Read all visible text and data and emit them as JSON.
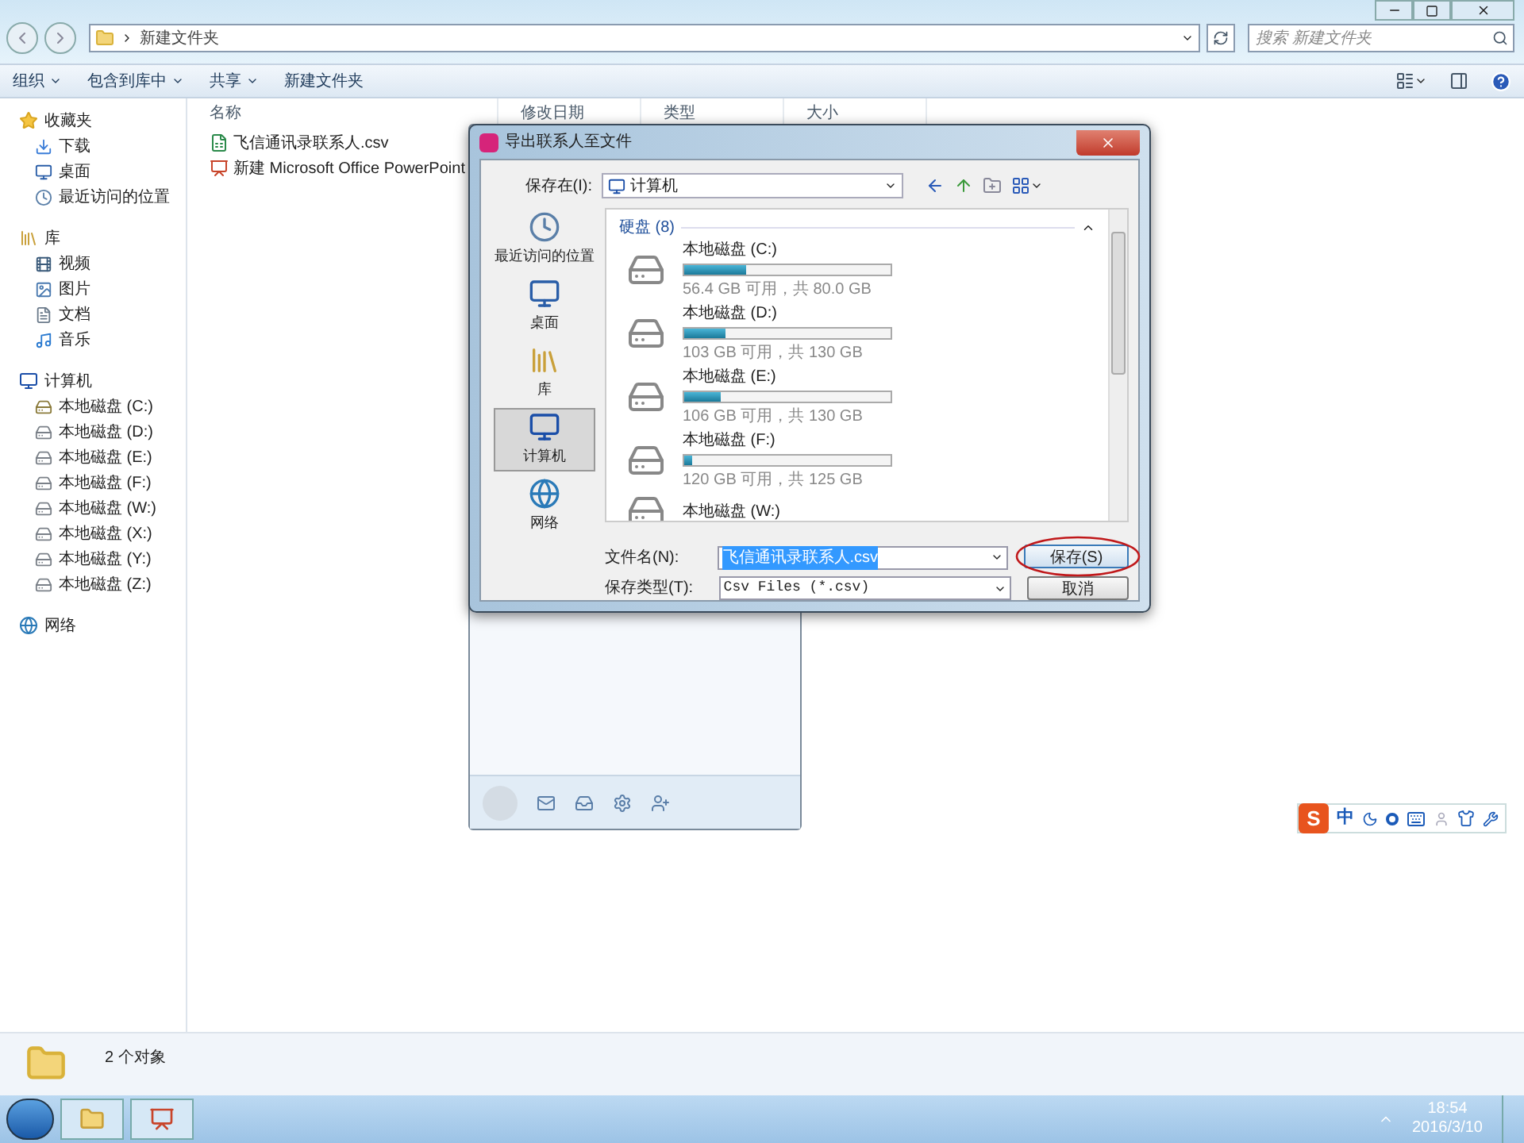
{
  "explorer": {
    "breadcrumb": "新建文件夹",
    "search": {
      "placeholder": "搜索 新建文件夹"
    },
    "toolbar": [
      {
        "label": "组织",
        "has_menu": true
      },
      {
        "label": "包含到库中",
        "has_menu": true
      },
      {
        "label": "共享",
        "has_menu": true
      },
      {
        "label": "新建文件夹",
        "has_menu": false
      }
    ],
    "sidebar": [
      {
        "label": "收藏夹",
        "kind": "favorites",
        "children": [
          {
            "label": "下载",
            "kind": "download"
          },
          {
            "label": "桌面",
            "kind": "desktop"
          },
          {
            "label": "最近访问的位置",
            "kind": "recent"
          }
        ]
      },
      {
        "label": "库",
        "kind": "library",
        "children": [
          {
            "label": "视频",
            "kind": "video"
          },
          {
            "label": "图片",
            "kind": "picture"
          },
          {
            "label": "文档",
            "kind": "document"
          },
          {
            "label": "音乐",
            "kind": "music"
          }
        ]
      },
      {
        "label": "计算机",
        "kind": "computer",
        "children": [
          {
            "label": "本地磁盘 (C:)",
            "kind": "system-drive"
          },
          {
            "label": "本地磁盘 (D:)",
            "kind": "drive"
          },
          {
            "label": "本地磁盘 (E:)",
            "kind": "drive"
          },
          {
            "label": "本地磁盘 (F:)",
            "kind": "drive"
          },
          {
            "label": "本地磁盘 (W:)",
            "kind": "drive"
          },
          {
            "label": "本地磁盘 (X:)",
            "kind": "drive"
          },
          {
            "label": "本地磁盘 (Y:)",
            "kind": "drive"
          },
          {
            "label": "本地磁盘 (Z:)",
            "kind": "drive"
          }
        ]
      },
      {
        "label": "网络",
        "kind": "network"
      }
    ],
    "columns": [
      "名称",
      "修改日期",
      "类型",
      "大小"
    ],
    "files": [
      {
        "name": "飞信通讯录联系人.csv",
        "kind": "csv"
      },
      {
        "name": "新建 Microsoft Office PowerPoint",
        "kind": "ppt"
      }
    ],
    "status": "2 个对象"
  },
  "dialog": {
    "title": "导出联系人至文件",
    "save_in_label": "保存在(I):",
    "save_in_value": "计算机",
    "places": [
      {
        "label": "最近访问的位置",
        "kind": "recent",
        "selected": false
      },
      {
        "label": "桌面",
        "kind": "desktop",
        "selected": false
      },
      {
        "label": "库",
        "kind": "library",
        "selected": false
      },
      {
        "label": "计算机",
        "kind": "computer",
        "selected": true
      },
      {
        "label": "网络",
        "kind": "network",
        "selected": false
      }
    ],
    "group": "硬盘 (8)",
    "drives": [
      {
        "name": "本地磁盘 (C:)",
        "level": 0.3,
        "reading": "56.4 GB 可用，共 80.0 GB"
      },
      {
        "name": "本地磁盘 (D:)",
        "level": 0.2,
        "reading": "103 GB 可用，共 130 GB"
      },
      {
        "name": "本地磁盘 (E:)",
        "level": 0.18,
        "reading": "106 GB 可用，共 130 GB"
      },
      {
        "name": "本地磁盘 (F:)",
        "level": 0.04,
        "reading": "120 GB 可用，共 125 GB"
      },
      {
        "name": "本地磁盘 (W:)"
      }
    ],
    "filename_label": "文件名(N):",
    "filename_value": "飞信通讯录联系人.csv",
    "filetype_label": "保存类型(T):",
    "filetype_value": "Csv Files (*.csv)",
    "buttons": [
      "保存(S)",
      "取消"
    ]
  },
  "ime": {
    "logo": "S",
    "mode": "中"
  },
  "taskbar": {
    "time": "18:54",
    "date": "2016/3/10"
  }
}
